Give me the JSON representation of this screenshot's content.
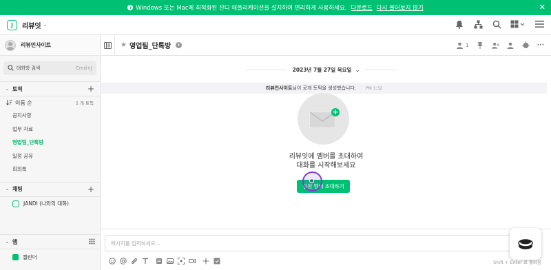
{
  "banner": {
    "message": "Windows 또는 Mac에 최적화된 잔디 애플리케이션을 설치하여 편리하게 사용하세요.",
    "download_label": "다운로드",
    "dismiss_label": "다시 물어보지 않기",
    "close_glyph": "✕",
    "info_glyph": "i"
  },
  "topbar": {
    "team_name": "리뷰잇",
    "logo_glyph": "J",
    "chev": "⌄"
  },
  "sidebar": {
    "profile_name": "리뷰인사이트",
    "search_label": "대화방 검색",
    "search_shortcut": "Cmd+J",
    "topics_title": "토픽",
    "sort_label": "이름 순",
    "topic_count": "5 개 토픽",
    "topics": [
      {
        "label": "공지사항"
      },
      {
        "label": "업무 자료"
      },
      {
        "label": "영업팀_단톡방"
      },
      {
        "label": "일정 공유"
      },
      {
        "label": "회의록"
      }
    ],
    "chat_title": "채팅",
    "dm_label": "JANDI (나와의 대화)",
    "app_title": "앱",
    "calendar_label": "캘린더",
    "caret": "⌄",
    "plus": "+"
  },
  "header": {
    "star": "★",
    "room_title": "영업팀_단톡방",
    "info_glyph": "i",
    "member_count": "1",
    "more": "···"
  },
  "main": {
    "date_label": "2023년 7월 27일 목요일",
    "date_chev": "⌄",
    "sys_author": "리뷰인사이트",
    "sys_text": " 님이 공개 토픽을 생성했습니다.",
    "sys_time": "PM 1:32",
    "plus_glyph": "+",
    "prompt_line1": "리뷰잇에 멤버를 초대하여",
    "prompt_line2": "대화를 시작해보세요",
    "invite_label": "팀원 멤버 초대하기"
  },
  "composer": {
    "placeholder": "메시지를 입력하세요...",
    "send_hint": "Shift + Enter 로 줄바꿈"
  },
  "colors": {
    "brand": "#00c073",
    "cursor": "#7d3fd1"
  }
}
